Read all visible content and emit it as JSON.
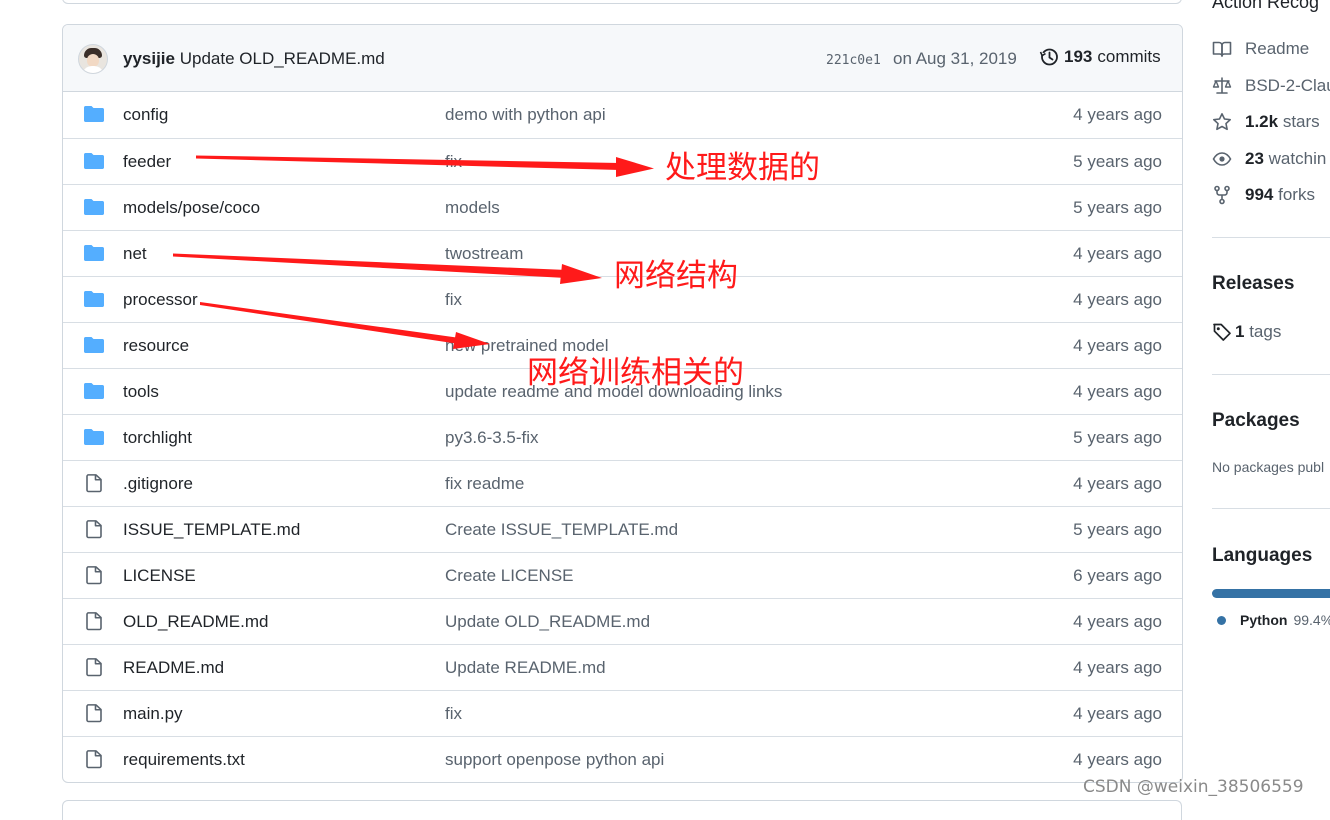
{
  "commit": {
    "author": "yysijie",
    "message": "Update OLD_README.md",
    "sha": "221c0e1",
    "date": "on Aug 31, 2019",
    "count": "193",
    "count_label": "commits"
  },
  "files": [
    {
      "type": "dir",
      "name": "config",
      "message": "demo with python api",
      "age": "4 years ago"
    },
    {
      "type": "dir",
      "name": "feeder",
      "message": "fix",
      "age": "5 years ago"
    },
    {
      "type": "dir",
      "name": "models/pose/coco",
      "message": "models",
      "age": "5 years ago"
    },
    {
      "type": "dir",
      "name": "net",
      "message": "twostream",
      "age": "4 years ago"
    },
    {
      "type": "dir",
      "name": "processor",
      "message": "fix",
      "age": "4 years ago"
    },
    {
      "type": "dir",
      "name": "resource",
      "message": "new pretrained model",
      "age": "4 years ago"
    },
    {
      "type": "dir",
      "name": "tools",
      "message": "update readme and model downloading links",
      "age": "4 years ago"
    },
    {
      "type": "dir",
      "name": "torchlight",
      "message": "py3.6-3.5-fix",
      "age": "5 years ago"
    },
    {
      "type": "file",
      "name": ".gitignore",
      "message": "fix readme",
      "age": "4 years ago"
    },
    {
      "type": "file",
      "name": "ISSUE_TEMPLATE.md",
      "message": "Create ISSUE_TEMPLATE.md",
      "age": "5 years ago"
    },
    {
      "type": "file",
      "name": "LICENSE",
      "message": "Create LICENSE",
      "age": "6 years ago"
    },
    {
      "type": "file",
      "name": "OLD_README.md",
      "message": "Update OLD_README.md",
      "age": "4 years ago"
    },
    {
      "type": "file",
      "name": "README.md",
      "message": "Update README.md",
      "age": "4 years ago"
    },
    {
      "type": "file",
      "name": "main.py",
      "message": "fix",
      "age": "4 years ago"
    },
    {
      "type": "file",
      "name": "requirements.txt",
      "message": "support openpose python api",
      "age": "4 years ago"
    }
  ],
  "annotations": {
    "feeder": "处理数据的",
    "net": "网络结构",
    "processor": "网络训练相关的"
  },
  "sidebar": {
    "title": "Action Recog",
    "readme": "Readme",
    "license": "BSD-2-Clau",
    "stars_count": "1.2k",
    "stars_label": "stars",
    "watching_count": "23",
    "watching_label": "watchin",
    "forks_count": "994",
    "forks_label": "forks",
    "releases_heading": "Releases",
    "tags_count": "1",
    "tags_label": "tags",
    "packages_heading": "Packages",
    "packages_text": "No packages publ",
    "languages_heading": "Languages",
    "language_name": "Python",
    "language_pct": "99.4%"
  },
  "watermark": "CSDN @weixin_38506559",
  "colors": {
    "folder": "#54aeff",
    "annotation": "#ff1a1a",
    "python": "#3572a5"
  },
  "icons": {
    "dir": "folder-icon",
    "file": "file-icon"
  }
}
